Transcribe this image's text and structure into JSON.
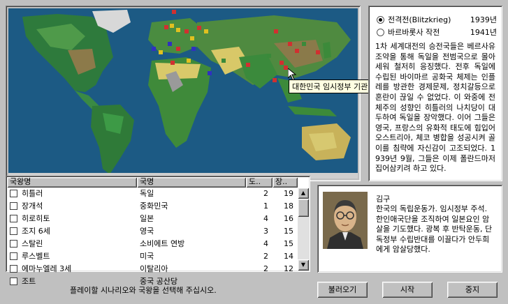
{
  "map": {
    "tooltip": "대한민국 임시정부 기관"
  },
  "scenarios": [
    {
      "label": "전격전(Blitzkrieg)",
      "year": "1939년",
      "selected": true
    },
    {
      "label": "바르바롯사 작전",
      "year": "1941년",
      "selected": false
    }
  ],
  "scenario_description": "1차 세계대전의 승전국들은 베르사유 조약을 통해 독일을 전범국으로 몰아세워 철저히 응징했다. 전후 독일에 수립된 바이마르 공화국 체제는 인플레를 방관한 경제문제, 정치갈등으로 혼란이 끊일 수 없었다. 이 와중에 전체주의 성향인 히틀러의 나치당이 대두하여 독일을 장악했다. 이어 그들은 영국, 프랑스의 유화적 태도에 힘입어 오스트리아, 체코 병합을 성공시켜 골이를 침략에 자신감이 고조되었다. 1939년 9월, 그들은 이제 폴란드마저 집어삼키려 하고 있다.",
  "list": {
    "headers": [
      "국왕명",
      "국명",
      "도..",
      "장.."
    ],
    "rows": [
      {
        "leader": "히틀러",
        "nation": "독일",
        "a": "2",
        "b": "19"
      },
      {
        "leader": "장개석",
        "nation": "중화민국",
        "a": "1",
        "b": "18"
      },
      {
        "leader": "히로히토",
        "nation": "일본",
        "a": "4",
        "b": "16"
      },
      {
        "leader": "조지 6세",
        "nation": "영국",
        "a": "3",
        "b": "15"
      },
      {
        "leader": "스탈린",
        "nation": "소비에트 연방",
        "a": "4",
        "b": "15"
      },
      {
        "leader": "루스벨트",
        "nation": "미국",
        "a": "2",
        "b": "14"
      },
      {
        "leader": "에마누엘레 3세",
        "nation": "이탈리아",
        "a": "2",
        "b": "12"
      },
      {
        "leader": "조트",
        "nation": "중국 공산당",
        "a": "",
        "b": ""
      }
    ]
  },
  "leader": {
    "name": "김구",
    "description": "한국의 독립운동가. 임시정부 주석. 한인애국단을 조직하여 일본요인 암살을 기도했다. 광복 후 반탁운동, 단독정부 수립반대를 이끌다가 안두희에게 암살당했다."
  },
  "status_text": "플레이할 시나리오와 국왕을 선택해 주십시오.",
  "buttons": {
    "load": "불러오기",
    "start": "시작",
    "stop": "중지"
  }
}
